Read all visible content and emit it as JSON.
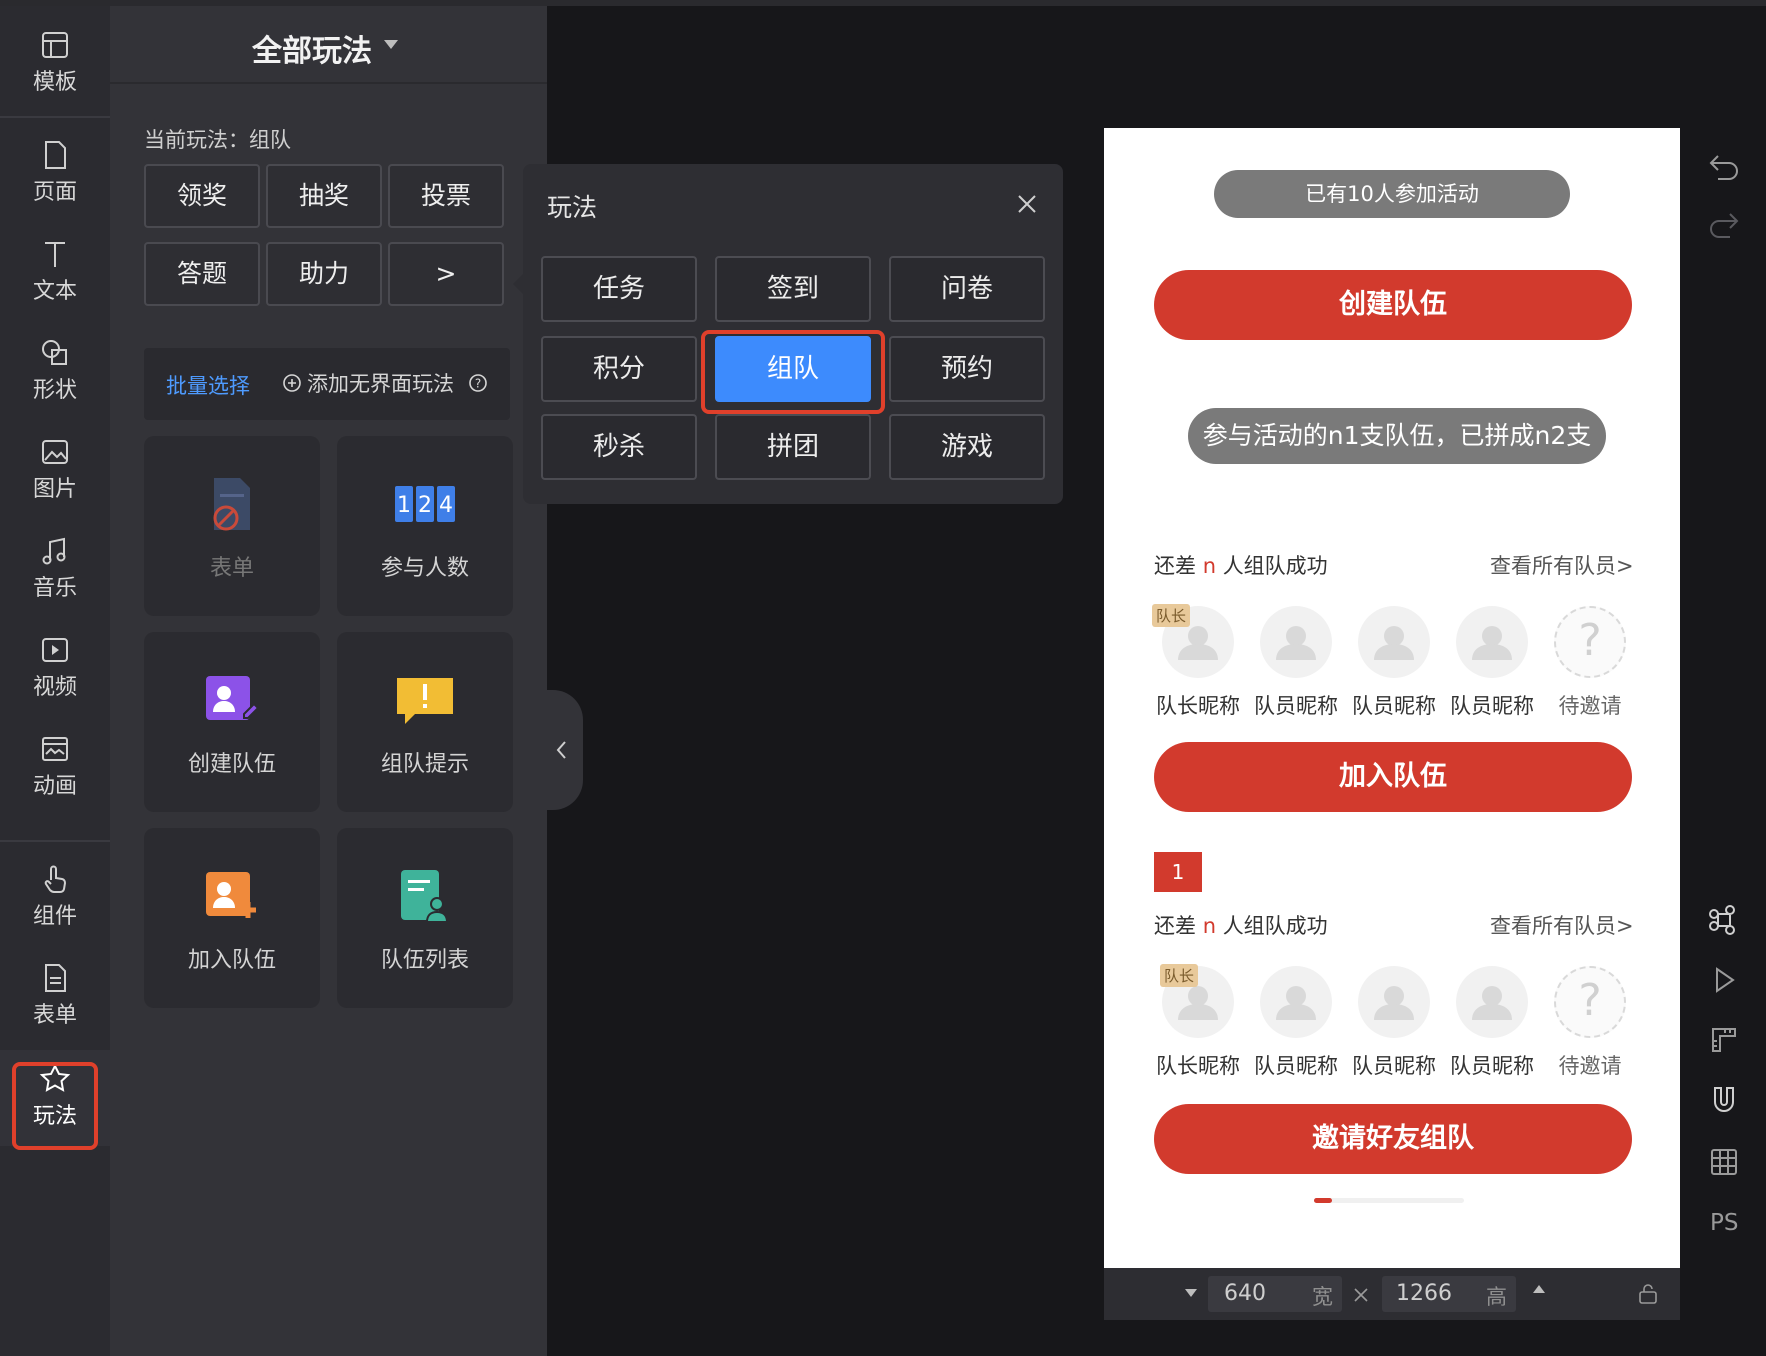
{
  "rail": {
    "items": [
      {
        "label": "模板",
        "icon": "template-icon"
      },
      {
        "label": "页面",
        "icon": "page-icon"
      },
      {
        "label": "文本",
        "icon": "text-icon"
      },
      {
        "label": "形状",
        "icon": "shape-icon"
      },
      {
        "label": "图片",
        "icon": "image-icon"
      },
      {
        "label": "音乐",
        "icon": "music-icon"
      },
      {
        "label": "视频",
        "icon": "video-icon"
      },
      {
        "label": "动画",
        "icon": "animation-icon"
      },
      {
        "label": "组件",
        "icon": "component-icon"
      },
      {
        "label": "表单",
        "icon": "form-icon"
      },
      {
        "label": "玩法",
        "icon": "play-icon"
      }
    ]
  },
  "panel": {
    "title": "全部玩法",
    "current": "当前玩法：组队",
    "buttons": [
      "领奖",
      "抽奖",
      "投票",
      "答题",
      "助力",
      ">"
    ],
    "batch_select": "批量选择",
    "add_interactive": "添加无界面玩法",
    "cards": [
      {
        "label": "表单",
        "icon": "form-disabled-icon"
      },
      {
        "label": "参与人数",
        "icon": "counter-icon"
      },
      {
        "label": "创建队伍",
        "icon": "create-team-icon"
      },
      {
        "label": "组队提示",
        "icon": "team-tip-icon"
      },
      {
        "label": "加入队伍",
        "icon": "join-team-icon"
      },
      {
        "label": "队伍列表",
        "icon": "team-list-icon"
      }
    ]
  },
  "popup": {
    "title": "玩法",
    "options": [
      "任务",
      "签到",
      "问卷",
      "积分",
      "组队",
      "预约",
      "秒杀",
      "拼团",
      "游戏"
    ],
    "selected": "组队"
  },
  "phone": {
    "participants": "已有10人参加活动",
    "create_team": "创建队伍",
    "summary": "参与活动的n1支队伍，已拼成n2支",
    "need_prefix": "还差",
    "need_n": "n",
    "need_suffix": "人组队成功",
    "view_all": "查看所有队员>",
    "captain_tag": "队长",
    "members": [
      "队长昵称",
      "队员昵称",
      "队员昵称",
      "队员昵称",
      "待邀请"
    ],
    "join_team": "加入队伍",
    "rank": "1",
    "invite": "邀请好友组队"
  },
  "size": {
    "width": "640",
    "width_unit": "宽",
    "height": "1266",
    "height_unit": "高"
  },
  "tools": {
    "ps": "PS"
  },
  "colors": {
    "accent_red": "#d23a2d",
    "select_blue": "#3d8bfd",
    "highlight_outline": "#e0402b"
  }
}
